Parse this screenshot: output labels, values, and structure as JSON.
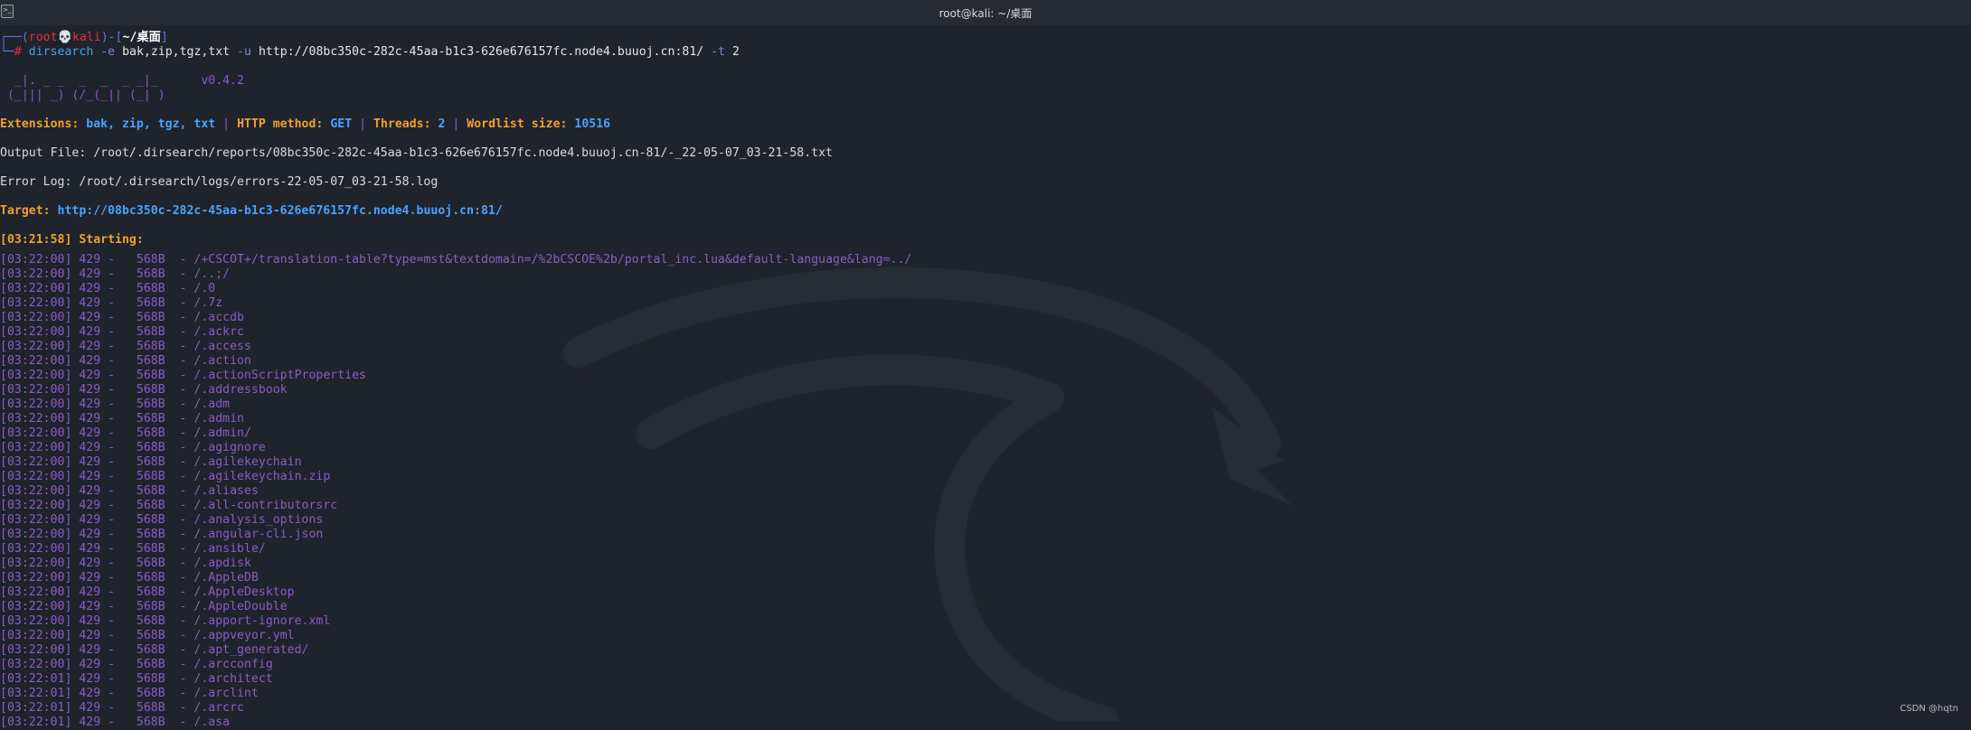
{
  "window": {
    "title": "root@kali: ~/桌面",
    "icon": "terminal-icon"
  },
  "prompt": {
    "open": "┌──(",
    "user": "root",
    "skull": "💀",
    "host": "kali",
    "mid": ")-[",
    "path": "~/桌面",
    "close": "]",
    "line2": "└─",
    "hash": "#"
  },
  "command": {
    "name": "dirsearch",
    "opt_e": "-e",
    "ext_arg": "bak,zip,tgz,txt",
    "opt_u": "-u",
    "url": "http://08bc350c-282c-45aa-b1c3-626e676157fc.node4.buuoj.cn:81/",
    "opt_t": "-t",
    "threads_arg": "2"
  },
  "logo": {
    "line1": "  _|. _ _  _  _  _ _|_",
    "line2": " (_||| _) (/_(_|| (_| )",
    "version": "v0.4.2"
  },
  "info": {
    "extensions_label": "Extensions:",
    "extensions": "bak, zip, tgz, txt",
    "sep": "|",
    "method_label": "HTTP method:",
    "method": "GET",
    "threads_label": "Threads:",
    "threads": "2",
    "wordlist_label": "Wordlist size:",
    "wordlist": "10516"
  },
  "output_file": "Output File: /root/.dirsearch/reports/08bc350c-282c-45aa-b1c3-626e676157fc.node4.buuoj.cn-81/-_22-05-07_03-21-58.txt",
  "error_log": "Error Log: /root/.dirsearch/logs/errors-22-05-07_03-21-58.log",
  "target": {
    "label": "Target:",
    "url": "http://08bc350c-282c-45aa-b1c3-626e676157fc.node4.buuoj.cn:81/"
  },
  "starting": "[03:21:58] Starting:",
  "results": [
    {
      "time": "[03:22:00]",
      "status": "429",
      "size": "568B",
      "path": "/+CSCOT+/translation-table?type=mst&textdomain=/%2bCSCOE%2b/portal_inc.lua&default-language&lang=../"
    },
    {
      "time": "[03:22:00]",
      "status": "429",
      "size": "568B",
      "path": "/..;/"
    },
    {
      "time": "[03:22:00]",
      "status": "429",
      "size": "568B",
      "path": "/.0"
    },
    {
      "time": "[03:22:00]",
      "status": "429",
      "size": "568B",
      "path": "/.7z"
    },
    {
      "time": "[03:22:00]",
      "status": "429",
      "size": "568B",
      "path": "/.accdb"
    },
    {
      "time": "[03:22:00]",
      "status": "429",
      "size": "568B",
      "path": "/.ackrc"
    },
    {
      "time": "[03:22:00]",
      "status": "429",
      "size": "568B",
      "path": "/.access"
    },
    {
      "time": "[03:22:00]",
      "status": "429",
      "size": "568B",
      "path": "/.action"
    },
    {
      "time": "[03:22:00]",
      "status": "429",
      "size": "568B",
      "path": "/.actionScriptProperties"
    },
    {
      "time": "[03:22:00]",
      "status": "429",
      "size": "568B",
      "path": "/.addressbook"
    },
    {
      "time": "[03:22:00]",
      "status": "429",
      "size": "568B",
      "path": "/.adm"
    },
    {
      "time": "[03:22:00]",
      "status": "429",
      "size": "568B",
      "path": "/.admin"
    },
    {
      "time": "[03:22:00]",
      "status": "429",
      "size": "568B",
      "path": "/.admin/"
    },
    {
      "time": "[03:22:00]",
      "status": "429",
      "size": "568B",
      "path": "/.agignore"
    },
    {
      "time": "[03:22:00]",
      "status": "429",
      "size": "568B",
      "path": "/.agilekeychain"
    },
    {
      "time": "[03:22:00]",
      "status": "429",
      "size": "568B",
      "path": "/.agilekeychain.zip"
    },
    {
      "time": "[03:22:00]",
      "status": "429",
      "size": "568B",
      "path": "/.aliases"
    },
    {
      "time": "[03:22:00]",
      "status": "429",
      "size": "568B",
      "path": "/.all-contributorsrc"
    },
    {
      "time": "[03:22:00]",
      "status": "429",
      "size": "568B",
      "path": "/.analysis_options"
    },
    {
      "time": "[03:22:00]",
      "status": "429",
      "size": "568B",
      "path": "/.angular-cli.json"
    },
    {
      "time": "[03:22:00]",
      "status": "429",
      "size": "568B",
      "path": "/.ansible/"
    },
    {
      "time": "[03:22:00]",
      "status": "429",
      "size": "568B",
      "path": "/.apdisk"
    },
    {
      "time": "[03:22:00]",
      "status": "429",
      "size": "568B",
      "path": "/.AppleDB"
    },
    {
      "time": "[03:22:00]",
      "status": "429",
      "size": "568B",
      "path": "/.AppleDesktop"
    },
    {
      "time": "[03:22:00]",
      "status": "429",
      "size": "568B",
      "path": "/.AppleDouble"
    },
    {
      "time": "[03:22:00]",
      "status": "429",
      "size": "568B",
      "path": "/.apport-ignore.xml"
    },
    {
      "time": "[03:22:00]",
      "status": "429",
      "size": "568B",
      "path": "/.appveyor.yml"
    },
    {
      "time": "[03:22:00]",
      "status": "429",
      "size": "568B",
      "path": "/.apt_generated/"
    },
    {
      "time": "[03:22:00]",
      "status": "429",
      "size": "568B",
      "path": "/.arcconfig"
    },
    {
      "time": "[03:22:01]",
      "status": "429",
      "size": "568B",
      "path": "/.architect"
    },
    {
      "time": "[03:22:01]",
      "status": "429",
      "size": "568B",
      "path": "/.arclint"
    },
    {
      "time": "[03:22:01]",
      "status": "429",
      "size": "568B",
      "path": "/.arcrc"
    },
    {
      "time": "[03:22:01]",
      "status": "429",
      "size": "568B",
      "path": "/.asa"
    }
  ],
  "watermark": "CSDN @hqtn"
}
